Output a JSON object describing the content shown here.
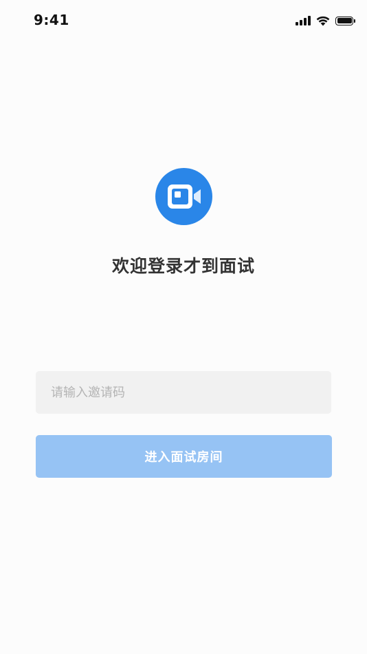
{
  "status_bar": {
    "time": "9:41",
    "icons": [
      "signal-icon",
      "wifi-icon",
      "battery-icon"
    ]
  },
  "logo": {
    "icon": "video-camera-icon",
    "color": "#2a86e8"
  },
  "welcome": {
    "title": "欢迎登录才到面试"
  },
  "invite_input": {
    "value": "",
    "placeholder": "请输入邀请码"
  },
  "enter_button": {
    "label": "进入面试房间",
    "color": "#96c3f4",
    "text_color": "#ffffff"
  }
}
